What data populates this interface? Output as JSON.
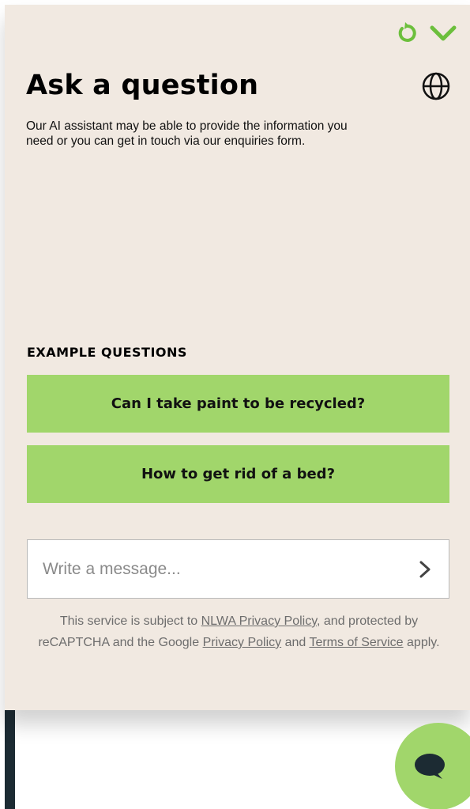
{
  "colors": {
    "panel_bg": "#f1e9e1",
    "accent_green": "#a1d66b",
    "icon_green": "#6cbf3c",
    "dark": "#1c2b33"
  },
  "icons": {
    "refresh": "refresh-icon",
    "collapse": "chevron-down-icon",
    "language": "globe-icon",
    "send": "chevron-right-icon",
    "chat": "chat-bubble-icon"
  },
  "header": {
    "title": "Ask a question",
    "intro": "Our AI assistant may be able to provide the information you need or you can get in touch via our enquiries form."
  },
  "examples": {
    "heading": "EXAMPLE QUESTIONS",
    "questions": [
      "Can I take paint to be recycled?",
      "How to get rid of a bed?"
    ]
  },
  "composer": {
    "placeholder": "Write a message...",
    "value": ""
  },
  "legal": {
    "text_1": "This service is subject to ",
    "link_privacy_nlwa": "NLWA Privacy Policy",
    "text_2": ", and protected by reCAPTCHA and the Google ",
    "link_privacy_google": "Privacy Policy",
    "text_3": " and ",
    "link_terms": "Terms of Service",
    "text_4": " apply."
  }
}
